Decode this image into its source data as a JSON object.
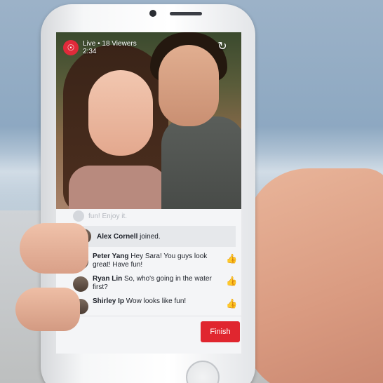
{
  "live": {
    "status": "Live • 18 Viewers",
    "timer": "2:34",
    "icon": "live-broadcast-icon"
  },
  "faded_comment": "fun! Enjoy it.",
  "joined": {
    "name": "Alex Cornell",
    "action": " joined."
  },
  "comments": [
    {
      "name": "Peter Yang",
      "text": " Hey Sara! You guys look great! Have fun!",
      "liked": true
    },
    {
      "name": "Ryan Lin",
      "text": " So, who's going in the water first?",
      "liked": false
    },
    {
      "name": "Shirley Ip",
      "text": " Wow looks like fun!",
      "liked": false
    }
  ],
  "finish_label": "Finish",
  "colors": {
    "live_red": "#e02a3a",
    "finish_red": "#e0262f",
    "like_blue": "#4267b2"
  }
}
